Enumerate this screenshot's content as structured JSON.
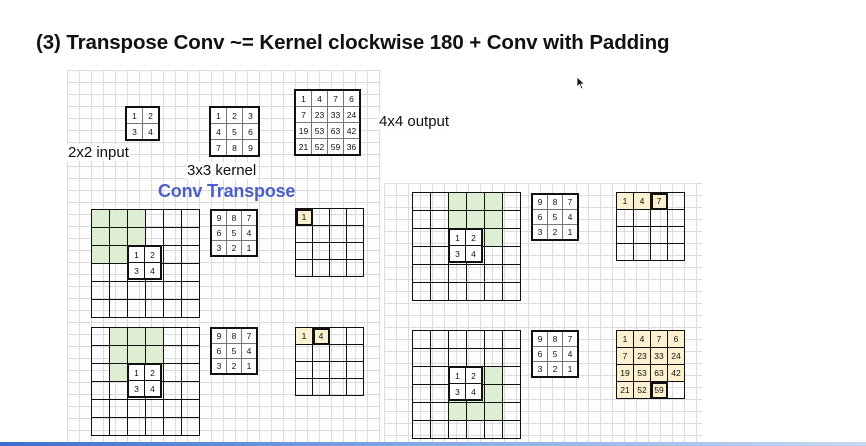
{
  "title": "(3) Transpose Conv ~= Kernel clockwise 180 + Conv with Padding",
  "labels": {
    "input": "2x2 input",
    "kernel": "3x3 kernel",
    "output": "4x4 output",
    "conv_transpose": "Conv Transpose"
  },
  "input_matrix": [
    [
      "1",
      "2"
    ],
    [
      "3",
      "4"
    ]
  ],
  "kernel_matrix": [
    [
      "1",
      "2",
      "3"
    ],
    [
      "4",
      "5",
      "6"
    ],
    [
      "7",
      "8",
      "9"
    ]
  ],
  "output_matrix": [
    [
      "1",
      "4",
      "7",
      "6"
    ],
    [
      "7",
      "23",
      "33",
      "24"
    ],
    [
      "19",
      "53",
      "63",
      "42"
    ],
    [
      "21",
      "52",
      "59",
      "36"
    ]
  ],
  "rotated_kernel": [
    [
      "9",
      "8",
      "7"
    ],
    [
      "6",
      "5",
      "4"
    ],
    [
      "3",
      "2",
      "1"
    ]
  ],
  "steps": [
    {
      "output": [
        "1"
      ]
    },
    {
      "output": [
        "1",
        "4"
      ]
    },
    {
      "output": [
        "1",
        "4",
        "7"
      ]
    },
    {
      "output": [
        "1",
        "4",
        "7",
        "6",
        "7",
        "23",
        "33",
        "24",
        "19",
        "53",
        "63",
        "42",
        "21",
        "52",
        "59"
      ]
    }
  ],
  "colors": {
    "title": "#111111",
    "accent_label": "#4a5fc8",
    "kernel_window_highlight": "#deeed3",
    "output_cell_fill": "#fbf0cf"
  }
}
